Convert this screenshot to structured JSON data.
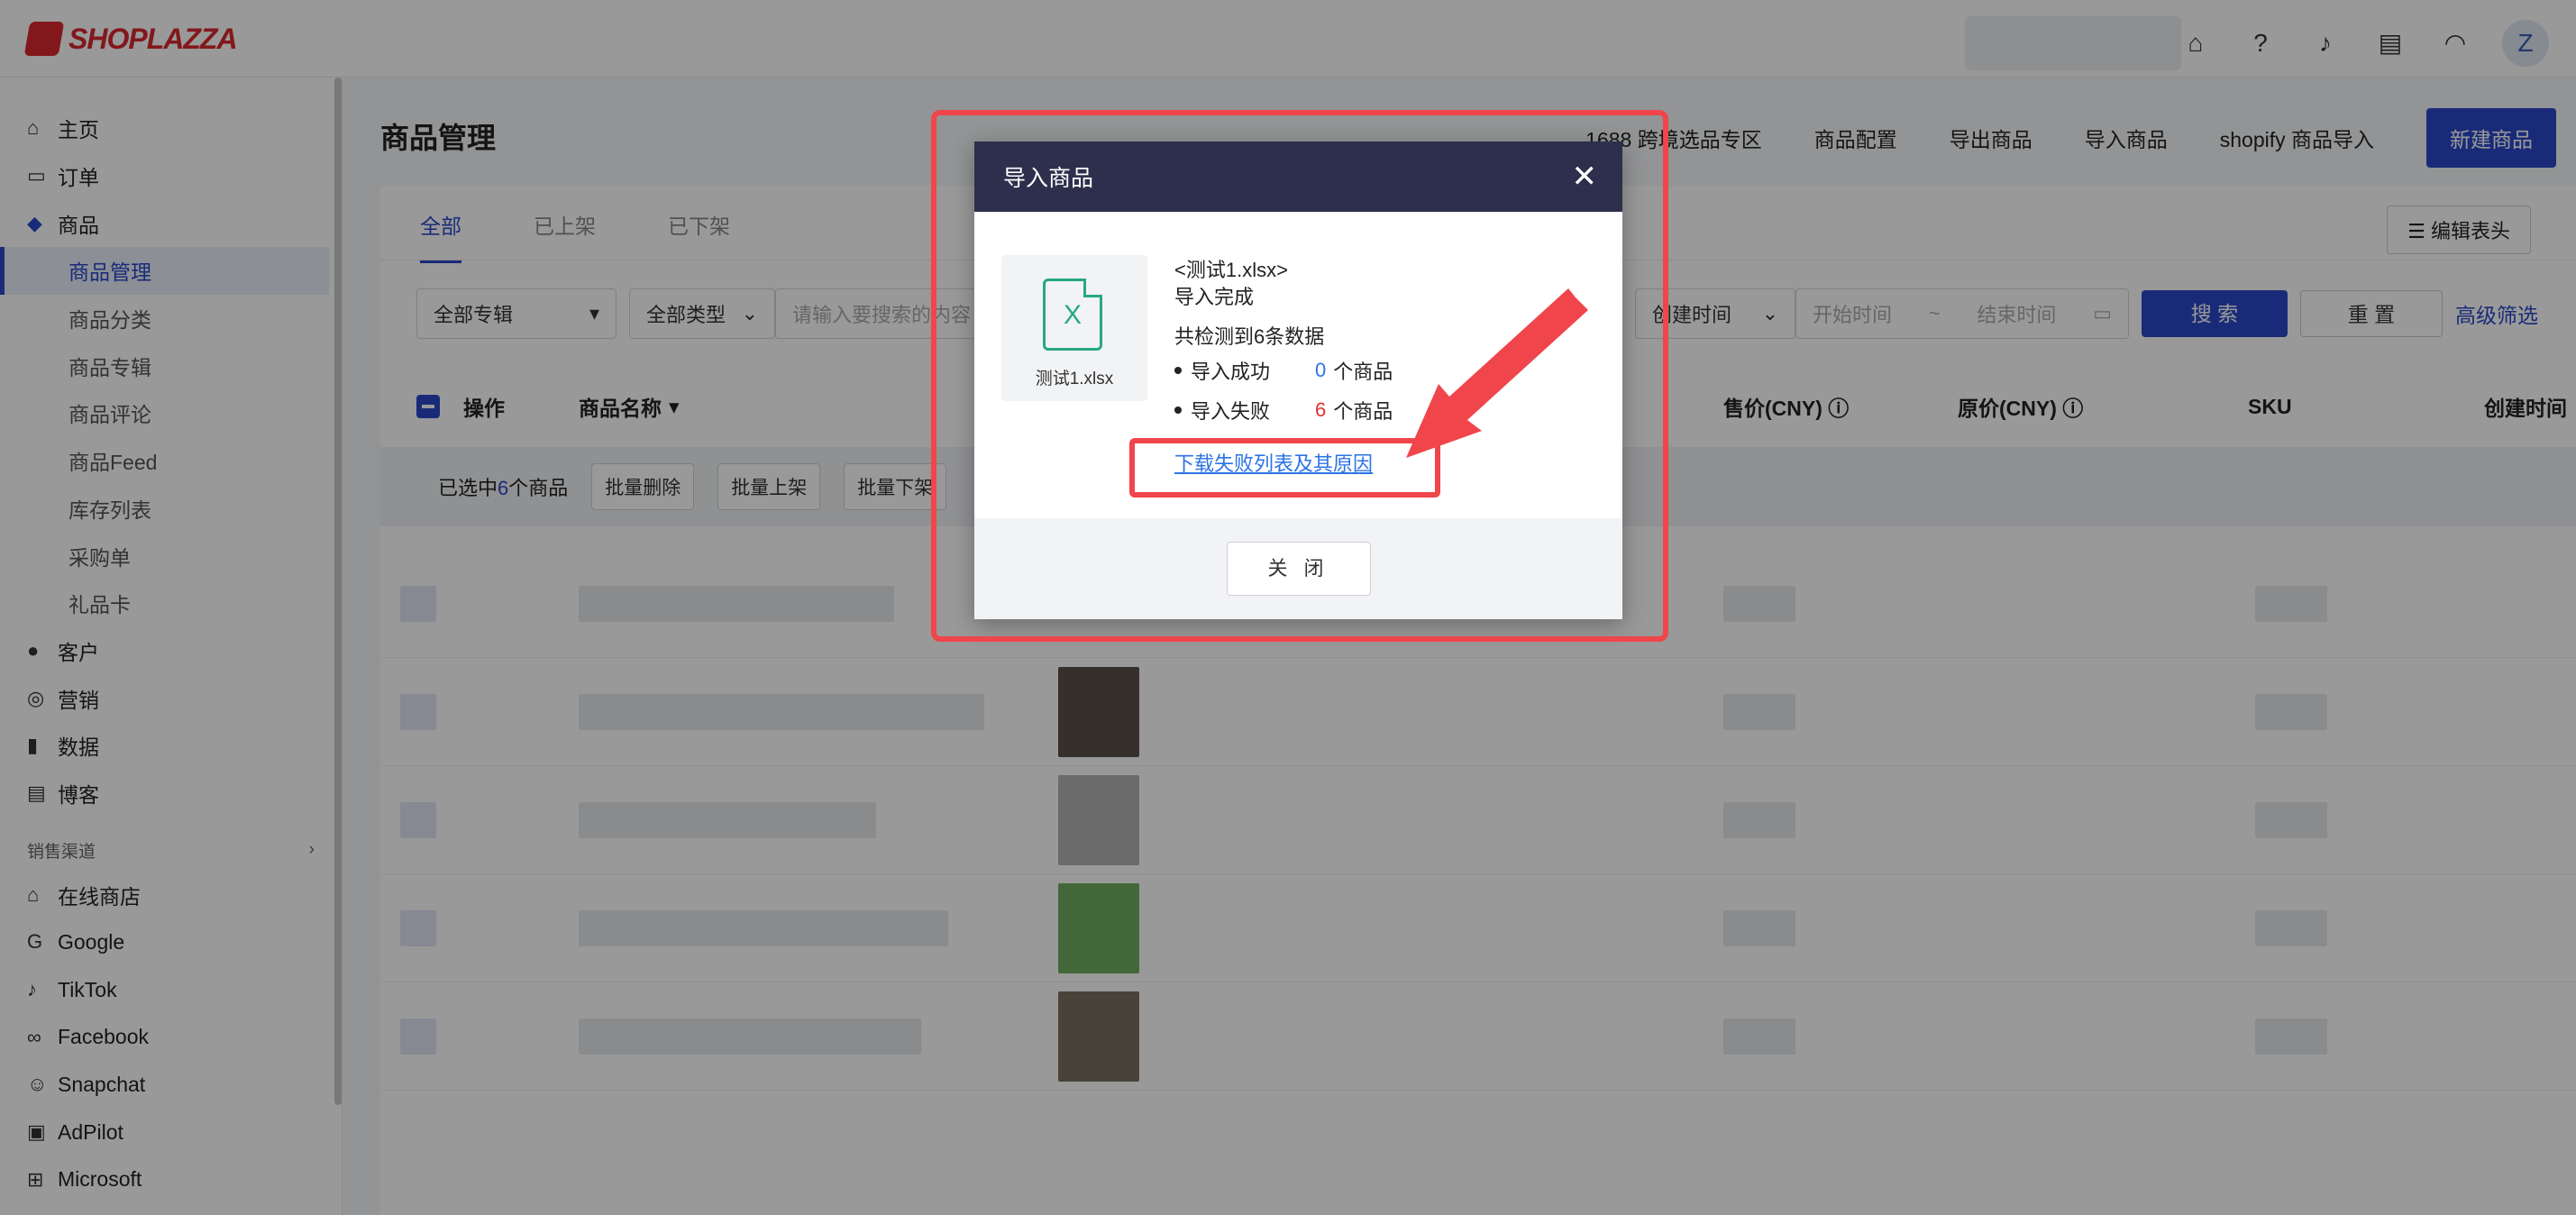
{
  "brand": {
    "logo_text": "SHOPLAZZA"
  },
  "topbar": {
    "avatar_letter": "Z",
    "icons": [
      "store-icon",
      "help-icon",
      "bell-icon",
      "chat-icon",
      "wifi-icon"
    ]
  },
  "sidebar": {
    "items": [
      {
        "label": "主页",
        "icon": "home-icon"
      },
      {
        "label": "订单",
        "icon": "inbox-icon"
      },
      {
        "label": "商品",
        "icon": "tag-icon"
      },
      {
        "label": "商品管理"
      },
      {
        "label": "商品分类"
      },
      {
        "label": "商品专辑"
      },
      {
        "label": "商品评论"
      },
      {
        "label": "商品Feed"
      },
      {
        "label": "库存列表"
      },
      {
        "label": "采购单"
      },
      {
        "label": "礼品卡"
      },
      {
        "label": "客户",
        "icon": "user-icon"
      },
      {
        "label": "营销",
        "icon": "marketing-icon"
      },
      {
        "label": "数据",
        "icon": "chart-icon"
      },
      {
        "label": "博客",
        "icon": "blog-icon"
      }
    ],
    "section_label": "销售渠道",
    "channels": [
      {
        "label": "在线商店",
        "icon": "store-icon"
      },
      {
        "label": "Google",
        "icon": "google-icon"
      },
      {
        "label": "TikTok",
        "icon": "tiktok-icon"
      },
      {
        "label": "Facebook",
        "icon": "meta-icon"
      },
      {
        "label": "Snapchat",
        "icon": "snapchat-icon"
      },
      {
        "label": "AdPilot",
        "icon": "ad-icon"
      },
      {
        "label": "Microsoft",
        "icon": "microsoft-icon"
      }
    ]
  },
  "page": {
    "title": "商品管理",
    "actions": [
      "1688 跨境选品专区",
      "商品配置",
      "导出商品",
      "导入商品",
      "shopify 商品导入"
    ],
    "primary_action": "新建商品",
    "tabs": [
      "全部",
      "已上架",
      "已下架"
    ],
    "edit_header": "编辑表头"
  },
  "filters": {
    "collection": "全部专辑",
    "type": "全部类型",
    "search_placeholder": "请输入要搜索的内容",
    "time_field": "创建时间",
    "start_placeholder": "开始时间",
    "tilde": "~",
    "end_placeholder": "结束时间",
    "search_btn": "搜 索",
    "reset_btn": "重 置",
    "advanced": "高级筛选"
  },
  "table": {
    "col_action": "操作",
    "col_name": "商品名称",
    "col_price": "售价(CNY)",
    "col_orig": "原价(CNY)",
    "col_sku": "SKU",
    "col_created": "创建时间"
  },
  "bulk": {
    "selected_prefix": "已选中",
    "selected_count": "6",
    "selected_suffix": "个商品",
    "delete": "批量删除",
    "publish": "批量上架",
    "unpublish": "批量下架"
  },
  "modal": {
    "title": "导入商品",
    "file_name": "测试1.xlsx",
    "file_tag": "<测试1.xlsx>",
    "status": "导入完成",
    "summary": "共检测到6条数据",
    "success_label": "导入成功",
    "success_count": "0",
    "fail_label": "导入失败",
    "fail_count": "6",
    "unit": "个商品",
    "download_link": "下载失败列表及其原因",
    "close_btn": "关 闭"
  },
  "colors": {
    "primary": "#2b48c9",
    "modal_header": "#2d2f4c",
    "success": "#2b73e6",
    "fail": "#e0312f",
    "annotation": "#f0454b"
  }
}
